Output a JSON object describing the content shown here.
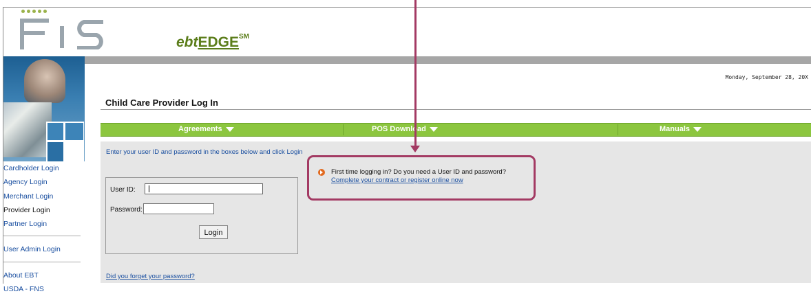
{
  "header": {
    "logo_text": "FIS",
    "brand": {
      "prefix": "ebt",
      "main": "EDGE",
      "mark": "SM"
    }
  },
  "date": "Monday, September 28, 20X",
  "page_title": "Child Care Provider Log In",
  "menu": {
    "agreements": "Agreements",
    "pos_download": "POS Download",
    "manuals": "Manuals"
  },
  "sidebar": {
    "items": [
      {
        "label": "Cardholder Login"
      },
      {
        "label": "Agency Login"
      },
      {
        "label": "Merchant Login"
      },
      {
        "label": "Provider Login"
      },
      {
        "label": "Partner Login"
      },
      {
        "label": "User Admin Login"
      },
      {
        "label": "About EBT"
      },
      {
        "label": "USDA - FNS"
      }
    ]
  },
  "login": {
    "instruction": "Enter your user ID and password in the boxes below and click Login",
    "user_id_label": "User ID:",
    "password_label": "Password:",
    "login_button": "Login",
    "forgot_link": "Did you forget your password?"
  },
  "first_time": {
    "question": "First time logging in? Do you need a User ID and password?",
    "register_link": "Complete your contract or register online now"
  },
  "colors": {
    "brand_green": "#5b7d1a",
    "menu_green": "#8cc63f",
    "callout": "#a33a63",
    "link_blue": "#1a4fa0"
  }
}
